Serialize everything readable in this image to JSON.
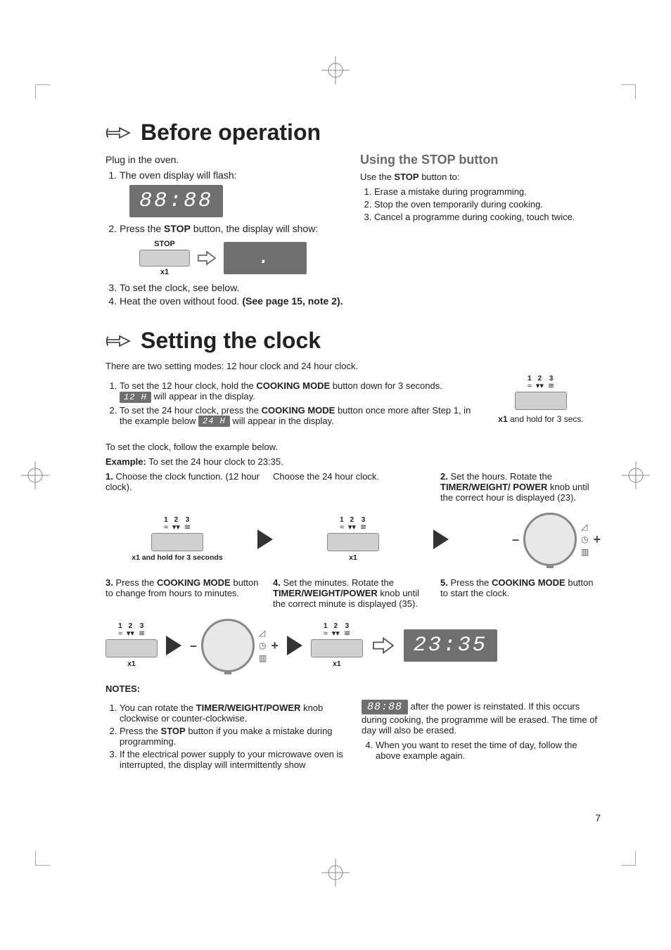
{
  "section1": {
    "title": "Before operation",
    "intro": "Plug in the oven.",
    "list": [
      "The oven display will flash:",
      "Press the STOP button, the display will show:",
      "To set the clock, see below.",
      "Heat the oven without food. (See page 15, note 2)."
    ],
    "step2_bold_a": "STOP",
    "step4_bold": "(See page 15, note 2).",
    "display_full": "88:88",
    "stop_label": "STOP",
    "x1": "x1",
    "display_colon": "."
  },
  "stopBtn": {
    "heading": "Using the STOP button",
    "intro_a": "Use the ",
    "intro_b": "STOP",
    "intro_c": " button to:",
    "list": [
      "Erase a mistake during programming.",
      "Stop the oven temporarily during cooking.",
      "Cancel a programme during cooking, touch twice."
    ]
  },
  "section2": {
    "title": "Setting the clock",
    "intro": "There are two setting modes: 12 hour clock and 24 hour clock.",
    "list1": {
      "a": "To set the 12 hour clock, hold the ",
      "bold": "COOKING MODE",
      "b": " button down for 3 seconds. ",
      "disp": "12 H",
      "c": " will appear in the display."
    },
    "list2": {
      "a": "To set the 24 hour clock, press the ",
      "bold": "COOKING MODE",
      "b": " button once more after Step 1, in the example below ",
      "disp": "24 H",
      "c": " will appear in the display."
    },
    "right_caption_a": "x1",
    "right_caption_b": " and hold for 3 secs.",
    "follow": "To set the clock, follow the example below.",
    "example_label": "Example:",
    "example_text": " To set the 24 hour clock to 23:35.",
    "steps_a": [
      {
        "n": "1.",
        "t": "Choose the clock function. (12 hour clock)."
      },
      {
        "n": "",
        "t": "Choose the 24 hour clock."
      },
      {
        "n": "2.",
        "tA": "Set the hours. Rotate the ",
        "tBold": "TIMER/WEIGHT/ POWER",
        "tB": " knob until the correct hour is displayed (23)."
      }
    ],
    "cap_hold3": "x1 and hold for 3 seconds",
    "cap_x1": "x1",
    "steps_b": [
      {
        "n": "3.",
        "tA": "Press the ",
        "tBold": "COOKING MODE",
        "tB": " button to change from hours to minutes."
      },
      {
        "n": "4.",
        "tA": "Set the minutes.  Rotate the ",
        "tBold": "TIMER/WEIGHT/POWER",
        "tB": " knob until the correct minute is displayed (35)."
      },
      {
        "n": "5.",
        "tA": "Press the ",
        "tBold": "COOKING MODE",
        "tB": " button to start the clock."
      }
    ],
    "final_display": "23:35"
  },
  "notes": {
    "heading": "NOTES:",
    "left": [
      {
        "a": "You can rotate the ",
        "bold": "TIMER/WEIGHT/POWER",
        "b": " knob clockwise or counter-clockwise."
      },
      {
        "a": "Press the ",
        "bold": "STOP",
        "b": " button if you make a mistake during programming."
      },
      {
        "a": "If the electrical power supply to your microwave oven is interrupted, the display will intermittently show",
        "bold": "",
        "b": ""
      }
    ],
    "right_disp": "88:88",
    "right_text": " after the power is reinstated. If this occurs during cooking, the programme will be erased. The time of day will also be erased.",
    "right_item4": "When you want to reset the time of day, follow the above example again."
  },
  "pageNumber": "7"
}
